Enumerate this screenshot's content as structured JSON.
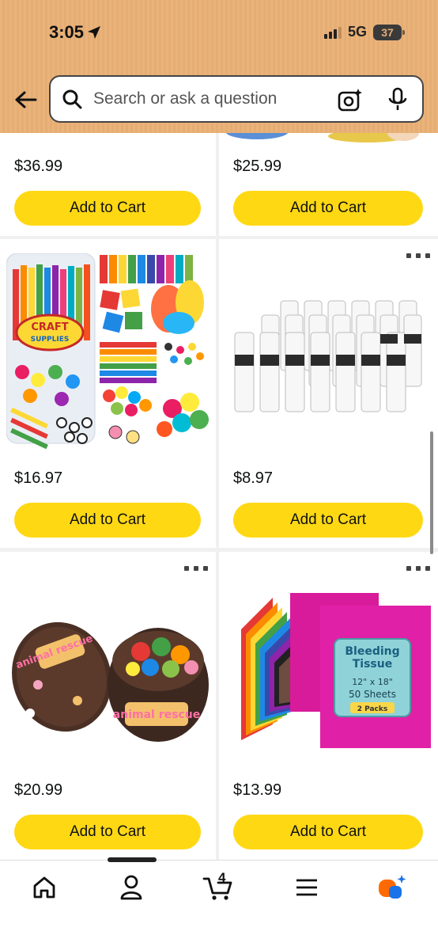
{
  "status_bar": {
    "time": "3:05",
    "network": "5G",
    "battery": "37"
  },
  "search": {
    "placeholder": "Search or ask a question"
  },
  "products": [
    {
      "price": "$36.99",
      "button": "Add to Cart"
    },
    {
      "price": "$25.99",
      "button": "Add to Cart"
    },
    {
      "price": "$16.97",
      "button": "Add to Cart",
      "image_text": "CRAFT SUPPLIES"
    },
    {
      "price": "$8.97",
      "button": "Add to Cart"
    },
    {
      "price": "$20.99",
      "button": "Add to Cart",
      "image_text": "animal rescue"
    },
    {
      "price": "$13.99",
      "button": "Add to Cart",
      "image_text": [
        "Bleeding",
        "Tissue",
        "12\" x 18\"",
        "50 Sheets",
        "2 Packs"
      ]
    }
  ],
  "tabbar": {
    "items": [
      "home-icon",
      "account-icon",
      "cart-icon",
      "menu-icon",
      "rufus-icon"
    ],
    "cart_count": "4",
    "accent": "#ff6a00"
  },
  "colors": {
    "button": "#ffd814",
    "header": "#eab37a"
  }
}
